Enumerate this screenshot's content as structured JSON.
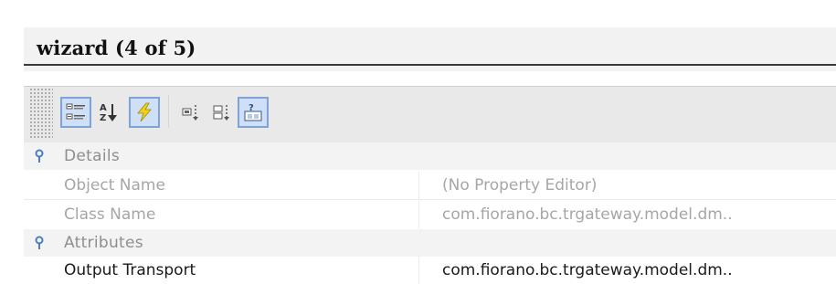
{
  "window": {
    "title": "wizard (4 of 5)"
  },
  "toolbar": {
    "buttons": [
      {
        "name": "categorized-icon",
        "selected": true
      },
      {
        "name": "sort-alpha-icon",
        "selected": false
      },
      {
        "name": "lightning-icon",
        "selected": true
      },
      {
        "name": "expand-icon",
        "selected": false
      },
      {
        "name": "collapse-icon",
        "selected": false
      },
      {
        "name": "help-description-icon",
        "selected": true
      }
    ]
  },
  "properties": {
    "categories": [
      {
        "label": "Details",
        "rows": [
          {
            "name": "Object Name",
            "value": "(No Property Editor)"
          },
          {
            "name": "Class Name",
            "value": "com.fiorano.bc.trgateway.model.dm.."
          }
        ]
      },
      {
        "label": "Attributes",
        "rows": [
          {
            "name": "Output Transport",
            "value": "com.fiorano.bc.trgateway.model.dm.."
          }
        ]
      }
    ]
  },
  "colors": {
    "selected_border": "#7ea3d6",
    "selected_fill": "#cfe0f6",
    "category_icon": "#4a7fc0"
  }
}
